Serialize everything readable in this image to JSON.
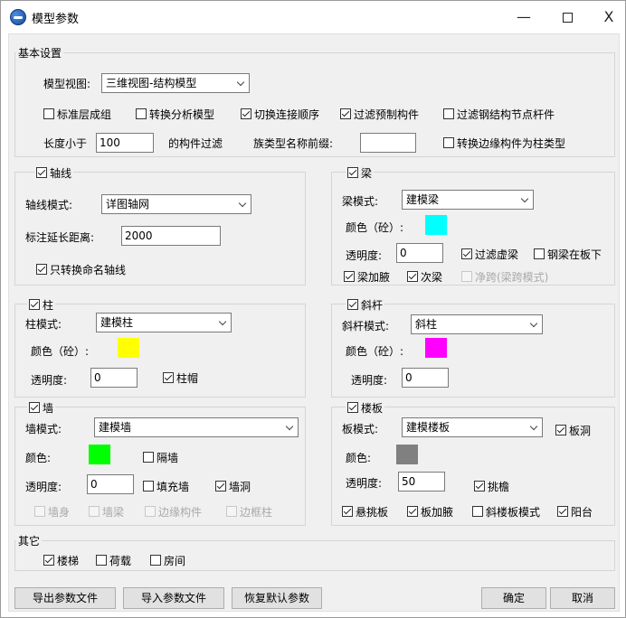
{
  "window": {
    "title": "模型参数",
    "min": "—",
    "close": "X"
  },
  "basic": {
    "title": "基本设置",
    "view_label": "模型视图:",
    "view_value": "三维视图-结构模型",
    "opt1": "标准层成组",
    "opt2": "转换分析模型",
    "opt3": "切换连接顺序",
    "opt4": "过滤预制构件",
    "opt5": "过滤钢结构节点杆件",
    "len_label": "长度小于",
    "len_value": "100",
    "len_suffix": "的构件过滤",
    "family_label": "族类型名称前缀:",
    "family_value": "",
    "edge_label": "转换边缘构件为柱类型"
  },
  "axis": {
    "title": "轴线",
    "mode_label": "轴线模式:",
    "mode_value": "详图轴网",
    "ext_label": "标注延长距离:",
    "ext_value": "2000",
    "named_label": "只转换命名轴线"
  },
  "beam": {
    "title": "梁",
    "mode_label": "梁模式:",
    "mode_value": "建模梁",
    "color_label": "颜色（砼）:",
    "color": "#00ffff",
    "trans_label": "透明度:",
    "trans_value": "0",
    "filter_virtual": "过滤虚梁",
    "steel_under_slab": "钢梁在板下",
    "haunch": "梁加腋",
    "secondary": "次梁",
    "net_span": "净跨(梁跨模式)"
  },
  "column": {
    "title": "柱",
    "mode_label": "柱模式:",
    "mode_value": "建模柱",
    "color_label": "颜色（砼）:",
    "color": "#ffff00",
    "trans_label": "透明度:",
    "trans_value": "0",
    "cap": "柱帽"
  },
  "brace": {
    "title": "斜杆",
    "mode_label": "斜杆模式:",
    "mode_value": "斜柱",
    "color_label": "颜色（砼）:",
    "color": "#ff00ff",
    "trans_label": "透明度:",
    "trans_value": "0"
  },
  "wall": {
    "title": "墙",
    "mode_label": "墙模式:",
    "mode_value": "建模墙",
    "color_label": "颜色:",
    "color": "#00ff00",
    "partition": "隔墙",
    "trans_label": "透明度:",
    "trans_value": "0",
    "infill": "填充墙",
    "opening": "墙洞",
    "body": "墙身",
    "wall_beam": "墙梁",
    "edge_member": "边缘构件",
    "edge_column": "边框柱"
  },
  "slab": {
    "title": "楼板",
    "mode_label": "板模式:",
    "mode_value": "建模楼板",
    "opening": "板洞",
    "color_label": "颜色:",
    "color": "#808080",
    "trans_label": "透明度:",
    "trans_value": "50",
    "eave": "挑檐",
    "cantilever": "悬挑板",
    "haunch": "板加腋",
    "sloped": "斜楼板模式",
    "balcony": "阳台"
  },
  "other": {
    "title": "其它",
    "stair": "楼梯",
    "load": "荷载",
    "room": "房间"
  },
  "buttons": {
    "export": "导出参数文件",
    "import": "导入参数文件",
    "restore": "恢复默认参数",
    "ok": "确定",
    "cancel": "取消"
  }
}
